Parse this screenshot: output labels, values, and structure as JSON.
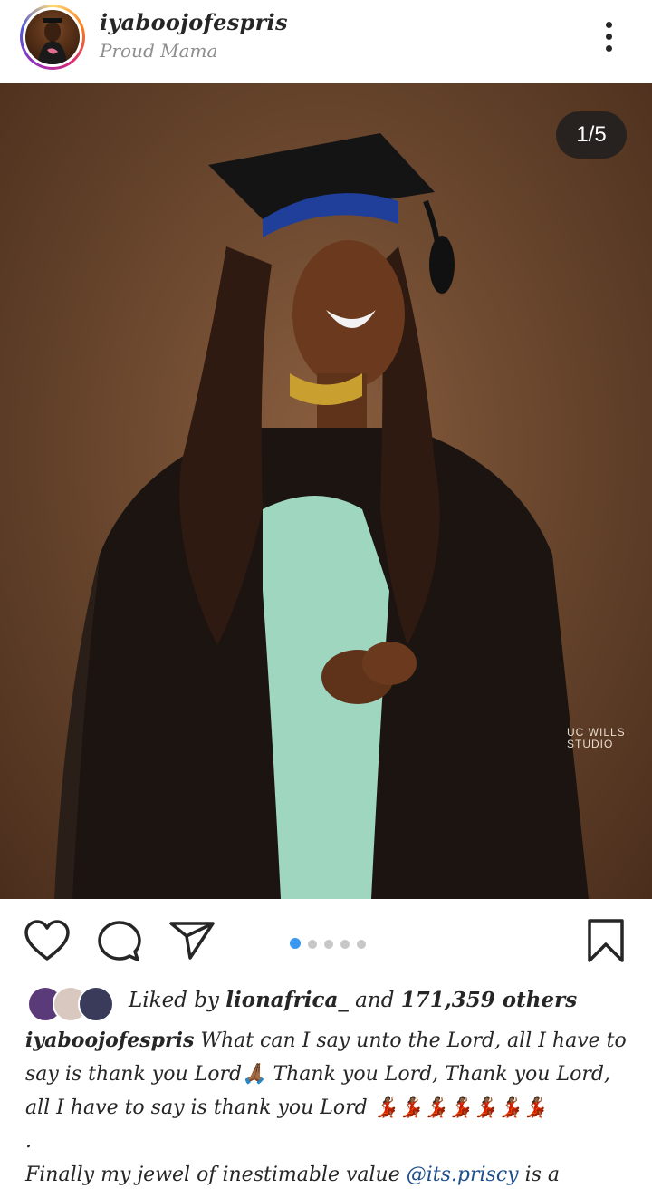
{
  "header": {
    "username": "iyaboojofespris",
    "subtitle": "Proud Mama",
    "avatar_icon": "profile-avatar"
  },
  "post": {
    "image_counter": "1/5",
    "watermark_line1": "UC WILLS",
    "watermark_line2": "STUDIO",
    "carousel_total": 5,
    "carousel_active": 1
  },
  "actions": {
    "like_icon": "heart-icon",
    "comment_icon": "comment-icon",
    "share_icon": "send-icon",
    "save_icon": "bookmark-icon"
  },
  "likes": {
    "prefix": "Liked by",
    "user": "lionafrica_",
    "joiner": "and",
    "count": "171,359 others"
  },
  "caption": {
    "username": "iyaboojofespris",
    "text1": "What can I say unto the Lord, all I have to say is thank you Lord🙏🏾 Thank you Lord, Thank you Lord, all I have to say is thank you Lord 💃🏾💃🏾💃🏾💃🏾💃🏾💃🏾💃🏾",
    "dot": ".",
    "text2": "Finally my jewel of inestimable value",
    "mention": "@its.priscy",
    "text3": "is a"
  },
  "colors": {
    "accent_blue": "#3897f0",
    "mention_blue": "#1e4f8c",
    "text": "#262626",
    "muted": "#8e8e8e"
  }
}
